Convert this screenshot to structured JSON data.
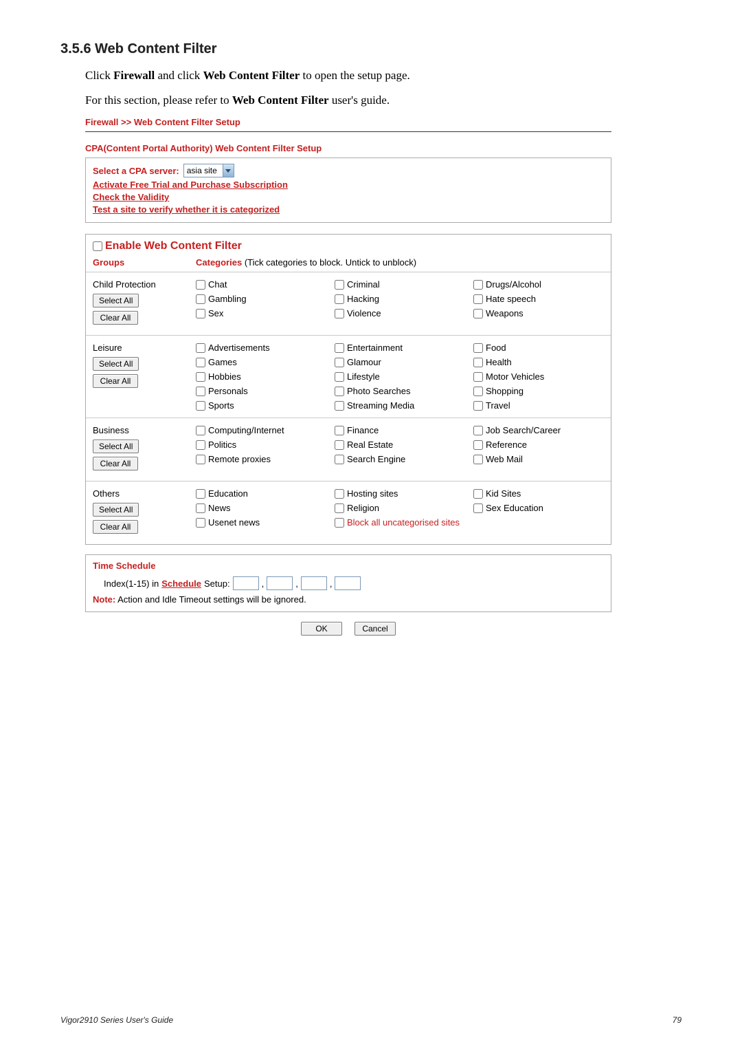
{
  "section_title": "3.5.6 Web Content Filter",
  "intro": {
    "line1_pre": "Click ",
    "firewall": "Firewall",
    "line1_mid": " and click ",
    "wcf": "Web Content Filter",
    "line1_post": " to open the setup page.",
    "line2_pre": "For this section, please refer to ",
    "wcf2": "Web Content Filter",
    "line2_post": " user's guide."
  },
  "breadcrumb": "Firewall >> Web Content Filter Setup",
  "cpa_title": "CPA(Content Portal Authority) Web Content Filter Setup",
  "cpa": {
    "select_label": "Select a CPA server:",
    "select_value": "asia site",
    "activate": "Activate Free Trial and Purchase Subscription",
    "check": "Check the Validity",
    "test": "Test a site to verify whether it is categorized"
  },
  "enable_label": "Enable Web Content Filter",
  "groups_label": "Groups",
  "categories_label": "Categories",
  "categories_desc": " (Tick categories to block. Untick to unblock)",
  "buttons": {
    "select_all": "Select All",
    "clear_all": "Clear All",
    "ok": "OK",
    "cancel": "Cancel"
  },
  "groups": [
    {
      "name": "Child Protection",
      "cats": [
        "Chat",
        "Criminal",
        "Drugs/Alcohol",
        "Gambling",
        "Hacking",
        "Hate speech",
        "Sex",
        "Violence",
        "Weapons"
      ]
    },
    {
      "name": "Leisure",
      "cats": [
        "Advertisements",
        "Entertainment",
        "Food",
        "Games",
        "Glamour",
        "Health",
        "Hobbies",
        "Lifestyle",
        "Motor Vehicles",
        "Personals",
        "Photo Searches",
        "Shopping",
        "Sports",
        "Streaming Media",
        "Travel"
      ]
    },
    {
      "name": "Business",
      "cats": [
        "Computing/Internet",
        "Finance",
        "Job Search/Career",
        "Politics",
        "Real Estate",
        "Reference",
        "Remote proxies",
        "Search Engine",
        "Web Mail"
      ]
    },
    {
      "name": "Others",
      "cats": [
        "Education",
        "Hosting sites",
        "Kid Sites",
        "News",
        "Religion",
        "Sex Education",
        "Usenet news"
      ],
      "extra_red": "Block all uncategorised sites"
    }
  ],
  "schedule": {
    "title": "Time Schedule",
    "index_pre": "Index(1-15) in  ",
    "schedule": "Schedule",
    "setup_post": " Setup:",
    "note_label": "Note:",
    "note_text": " Action and Idle Timeout settings will be ignored."
  },
  "footer": {
    "guide": "Vigor2910 Series User's Guide",
    "page": "79"
  }
}
